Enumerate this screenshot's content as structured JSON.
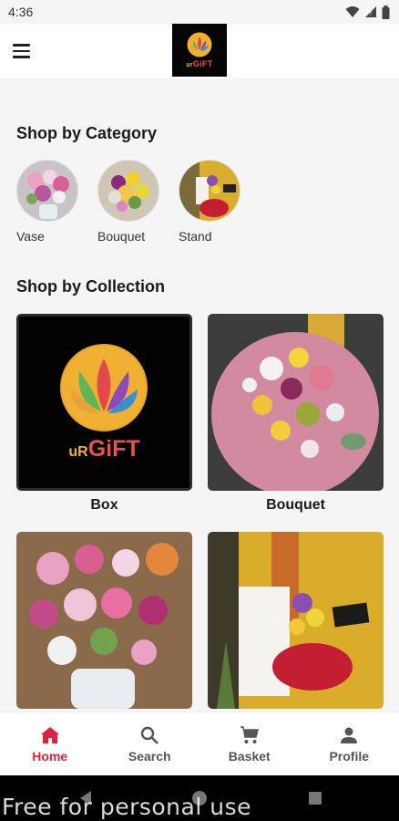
{
  "status": {
    "time": "4:36",
    "icons": [
      "wifi-icon",
      "signal-icon",
      "battery-icon"
    ]
  },
  "appbar": {
    "menu_icon": "menu-icon",
    "logo_text_small": "ur",
    "logo_text_main": "GiFT"
  },
  "category": {
    "title": "Shop by Category",
    "items": [
      {
        "label": "Vase"
      },
      {
        "label": "Bouquet"
      },
      {
        "label": "Stand"
      }
    ]
  },
  "collection": {
    "title": "Shop by Collection",
    "items": [
      {
        "label": "Box",
        "brand_small": "uR",
        "brand_main": "GiFT"
      },
      {
        "label": "Bouquet"
      },
      {
        "label": ""
      },
      {
        "label": ""
      }
    ]
  },
  "bottom_nav": {
    "items": [
      {
        "label": "Home",
        "icon": "home-icon",
        "active": true
      },
      {
        "label": "Search",
        "icon": "search-icon",
        "active": false
      },
      {
        "label": "Basket",
        "icon": "cart-icon",
        "active": false
      },
      {
        "label": "Profile",
        "icon": "profile-icon",
        "active": false
      }
    ]
  },
  "watermark": "Free for personal use",
  "colors": {
    "accent": "#e0203d",
    "background": "#f5f5f5"
  }
}
